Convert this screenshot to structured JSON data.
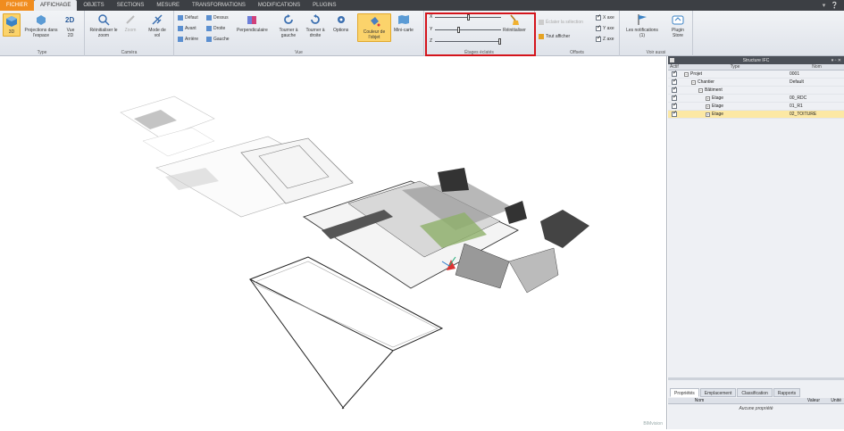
{
  "menu": {
    "tabs": [
      "FICHIER",
      "AFFICHAGE",
      "OBJETS",
      "SECTIONS",
      "MESURE",
      "TRANSFORMATIONS",
      "MODIFICATIONS",
      "PLUGINS"
    ]
  },
  "ribbon": {
    "type_group": {
      "label": "Type",
      "btn_3d": "3D",
      "btn_proj": "Projections dans l'espace",
      "btn_2d": "Vue 2D"
    },
    "camera_group": {
      "label": "Caméra",
      "btn_reset_zoom": "Réinitialiser le zoom",
      "btn_zoom": "Zoom",
      "btn_flight": "Mode de vol"
    },
    "view_group": {
      "label": "Vue",
      "default": "Défaut",
      "front": "Avant",
      "back": "Arrière",
      "top": "Dessus",
      "right": "Droite",
      "left": "Gauche",
      "perpendicular": "Perpendiculaire",
      "rotate_left": "Tourner à gauche",
      "rotate_right": "Tourner à droite",
      "options": "Options",
      "object_color": "Couleur de l'objet",
      "minimap": "Mini-carte"
    },
    "floors_group": {
      "label": "Étages éclatés",
      "x": "X",
      "y": "Y",
      "z": "Z",
      "reset": "Réinitialiser",
      "x_value": 0.5,
      "y_value": 0.35,
      "z_value": 1.0
    },
    "offsets_group": {
      "label": "Offsets",
      "explode_selection": "Éclater la sélection",
      "show_all": "Tout afficher",
      "x_axis": "X axe",
      "y_axis": "Y axe",
      "z_axis": "Z axe"
    },
    "notifications_group": {
      "label": "Voir aussi",
      "notifications": "Les notifications (1)",
      "plugin_store": "Plugin Store"
    }
  },
  "viewport": {
    "watermark": "BIMvision"
  },
  "panel": {
    "title": "Structure IFC",
    "columns": {
      "active": "Actif",
      "type": "Type",
      "nom": "Nom"
    },
    "rows": [
      {
        "type": "Projet",
        "nom": "0001",
        "depth": 0
      },
      {
        "type": "Chantier",
        "nom": "Default",
        "depth": 1
      },
      {
        "type": "Bâtiment",
        "nom": "",
        "depth": 2
      },
      {
        "type": "Etage",
        "nom": "00_RDC",
        "depth": 3
      },
      {
        "type": "Etage",
        "nom": "01_R1",
        "depth": 3
      },
      {
        "type": "Etage",
        "nom": "02_TOITURE",
        "depth": 3
      }
    ],
    "tabs": [
      "Propriétés",
      "Emplacement",
      "Classification",
      "Rapports"
    ],
    "prop_columns": {
      "nom": "Nom",
      "valeur": "Valeur",
      "unite": "Unité"
    },
    "no_property": "Aucune propriété"
  }
}
